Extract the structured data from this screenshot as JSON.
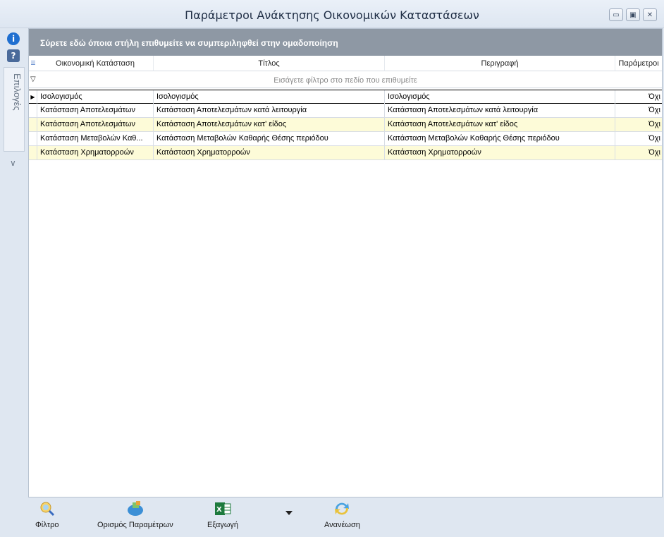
{
  "window": {
    "title": "Παράμετροι Ανάκτησης Οικονομικών Καταστάσεων",
    "buttons": {
      "minimize": "▭",
      "maximize": "▣",
      "close": "✕"
    }
  },
  "sidebar": {
    "info_icon": "i",
    "help_icon": "?",
    "options_label": "Επιλογές",
    "options_chevron": "∨"
  },
  "grid": {
    "group_panel_text": "Σύρετε εδώ όποια στήλη επιθυμείτε να συμπεριληφθεί στην ομαδοποίηση",
    "columns": [
      "Οικονομική Κατάσταση",
      "Τίτλος",
      "Περιγραφή",
      "Παράμετροι"
    ],
    "filter_placeholder": "Εισάγετε φίλτρο στο πεδίο που επιθυμείτε",
    "rows": [
      [
        "Ισολογισμός",
        "Ισολογισμός",
        "Ισολογισμός",
        "Όχι"
      ],
      [
        "Κατάσταση Αποτελεσμάτων",
        "Κατάσταση Αποτελεσμάτων κατά λειτουργία",
        "Κατάσταση Αποτελεσμάτων κατά λειτουργία",
        "Όχι"
      ],
      [
        "Κατάσταση Αποτελεσμάτων",
        "Κατάσταση Αποτελεσμάτων κατ' είδος",
        "Κατάσταση Αποτελεσμάτων κατ' είδος",
        "Όχι"
      ],
      [
        "Κατάσταση Μεταβολών Καθ...",
        "Κατάσταση Μεταβολών Καθαρής Θέσης περιόδου",
        "Κατάσταση Μεταβολών Καθαρής Θέσης περιόδου",
        "Όχι"
      ],
      [
        "Κατάσταση Χρηματορροών",
        "Κατάσταση Χρηματορροών",
        "Κατάσταση Χρηματορροών",
        "Όχι"
      ]
    ]
  },
  "toolbar": {
    "filter_label": "Φίλτρο",
    "params_label": "Ορισμός Παραμέτρων",
    "export_label": "Εξαγωγή",
    "refresh_label": "Ανανέωση"
  },
  "colors": {
    "group_panel": "#8e98a4",
    "alt_row": "#fdfbd8",
    "chrome": "#dfe7f1"
  }
}
